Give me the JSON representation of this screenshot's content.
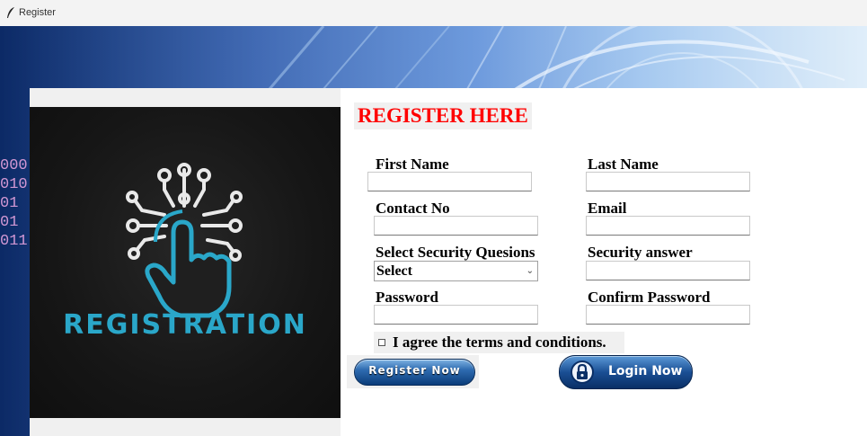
{
  "window": {
    "title": "Register"
  },
  "background": {
    "binary_lines": [
      "000",
      "010",
      "01",
      "01",
      "011"
    ]
  },
  "logo": {
    "text": "REGISTRATION"
  },
  "form": {
    "heading": "REGISTER HERE",
    "fields": {
      "first_name": {
        "label": "First Name",
        "value": ""
      },
      "last_name": {
        "label": "Last Name",
        "value": ""
      },
      "contact_no": {
        "label": "Contact No",
        "value": ""
      },
      "email": {
        "label": "Email",
        "value": ""
      },
      "security_question": {
        "label": "Select Security Quesions",
        "selected": "Select"
      },
      "security_answer": {
        "label": "Security answer",
        "value": ""
      },
      "password": {
        "label": "Password",
        "value": ""
      },
      "confirm_password": {
        "label": "Confirm Password",
        "value": ""
      }
    },
    "agree_label": "I agree the terms and conditions.",
    "agree_checked": false,
    "register_button": "Register Now",
    "login_button": "Login Now"
  },
  "colors": {
    "heading": "#ff0000",
    "logo_accent": "#2aa7c9",
    "button_blue": "#1a4f94"
  }
}
